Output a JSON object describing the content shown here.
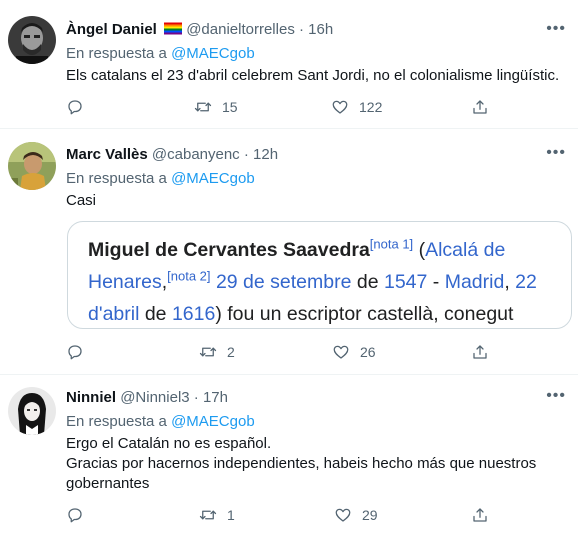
{
  "tweets": [
    {
      "name": "Àngel Daniel",
      "flag": "🏳️‍🌈",
      "handle": "@danieltorrelles",
      "separator": "·",
      "time": "16h",
      "reply_prefix": "En respuesta a",
      "reply_to": "@MAECgob",
      "text": [
        "Els catalans el 23 d'abril celebrem Sant Jordi, no el colonialisme lingüístic."
      ],
      "retweets": "15",
      "likes": "122"
    },
    {
      "name": "Marc Vallès",
      "handle": "@cabanyenc",
      "separator": "·",
      "time": "12h",
      "reply_prefix": "En respuesta a",
      "reply_to": "@MAECgob",
      "text": [
        "Casi"
      ],
      "retweets": "2",
      "likes": "26",
      "card": {
        "title": "Miguel de Cervantes Saavedra",
        "note1": "[nota 1]",
        "open_paren": " (",
        "place1": "Alcalá de Henares",
        "comma1": ",",
        "note2": "[nota 2]",
        "date1": "29 de setembre",
        "de1": " de ",
        "year1": "1547",
        "dash": " - ",
        "place2": "Madrid",
        "comma2": ", ",
        "date2": "22 d'abril",
        "de2": " de ",
        "year2": "1616",
        "rest": ") fou un escriptor castellà, conegut"
      }
    },
    {
      "name": "Ninniel",
      "handle": "@Ninniel3",
      "separator": "·",
      "time": "17h",
      "reply_prefix": "En respuesta a",
      "reply_to": "@MAECgob",
      "text": [
        "Ergo el Catalán no es español.",
        "Gracias por hacernos independientes, habeis hecho más que nuestros",
        "gobernantes"
      ],
      "retweets": "1",
      "likes": "29"
    }
  ],
  "icons": {
    "more": "more-icon",
    "reply": "reply-icon",
    "retweet": "retweet-icon",
    "like": "like-icon",
    "share": "share-icon"
  },
  "colors": {
    "link": "#1d9bf0",
    "muted": "#536471",
    "wiki_link": "#3366cc"
  }
}
